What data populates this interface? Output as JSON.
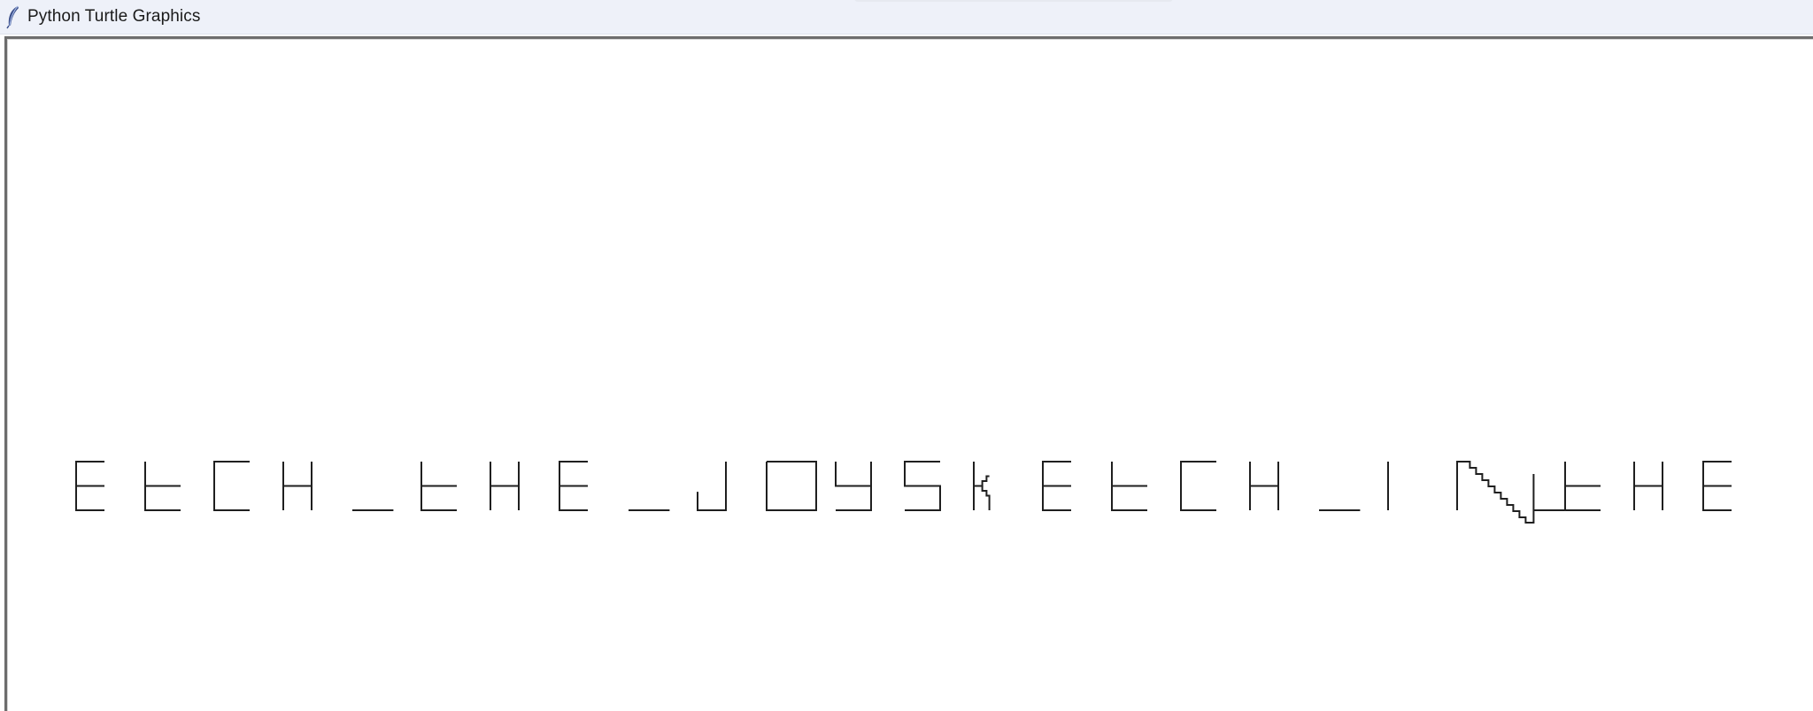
{
  "window": {
    "title": "Python Turtle Graphics",
    "icon": "feather-icon"
  },
  "canvas": {
    "background": "#ffffff",
    "pen_color": "#1f1f1f",
    "drawn_text": "ETCH_THE_JOYSKETCH_IN_THE_",
    "glyphs": [
      {
        "char": "E"
      },
      {
        "char": "T"
      },
      {
        "char": "C"
      },
      {
        "char": "H"
      },
      {
        "char": "_"
      },
      {
        "char": "T"
      },
      {
        "char": "H"
      },
      {
        "char": "E"
      },
      {
        "char": "_"
      },
      {
        "char": "J"
      },
      {
        "char": "O"
      },
      {
        "char": "Y"
      },
      {
        "char": "S"
      },
      {
        "char": "K"
      },
      {
        "char": "E"
      },
      {
        "char": "T"
      },
      {
        "char": "C"
      },
      {
        "char": "H"
      },
      {
        "char": "_"
      },
      {
        "char": "I"
      },
      {
        "char": "N"
      },
      {
        "char": "T"
      },
      {
        "char": "H"
      },
      {
        "char": "E"
      }
    ]
  }
}
